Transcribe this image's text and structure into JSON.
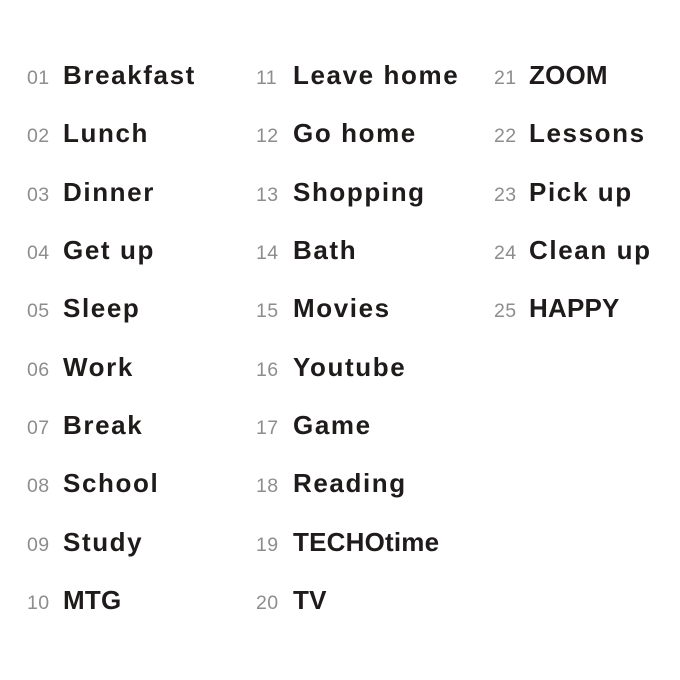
{
  "sheet": {
    "background_color": "#ffffff",
    "number_color": "#8d8d8d",
    "label_color": "#1f1b1b"
  },
  "columns": [
    {
      "name": "column-1",
      "entries": [
        {
          "number": "01",
          "label": "Breakfast"
        },
        {
          "number": "02",
          "label": "Lunch"
        },
        {
          "number": "03",
          "label": "Dinner"
        },
        {
          "number": "04",
          "label": "Get up"
        },
        {
          "number": "05",
          "label": "Sleep"
        },
        {
          "number": "06",
          "label": "Work"
        },
        {
          "number": "07",
          "label": "Break"
        },
        {
          "number": "08",
          "label": "School"
        },
        {
          "number": "09",
          "label": "Study"
        },
        {
          "number": "10",
          "label": "MTG"
        }
      ]
    },
    {
      "name": "column-2",
      "entries": [
        {
          "number": "11",
          "label": "Leave home"
        },
        {
          "number": "12",
          "label": "Go home"
        },
        {
          "number": "13",
          "label": "Shopping"
        },
        {
          "number": "14",
          "label": "Bath"
        },
        {
          "number": "15",
          "label": "Movies"
        },
        {
          "number": "16",
          "label": "Youtube"
        },
        {
          "number": "17",
          "label": "Game"
        },
        {
          "number": "18",
          "label": "Reading"
        },
        {
          "number": "19",
          "label": "TECHOtime"
        },
        {
          "number": "20",
          "label": "TV"
        }
      ]
    },
    {
      "name": "column-3",
      "entries": [
        {
          "number": "21",
          "label": "ZOOM"
        },
        {
          "number": "22",
          "label": "Lessons"
        },
        {
          "number": "23",
          "label": "Pick up"
        },
        {
          "number": "24",
          "label": "Clean up"
        },
        {
          "number": "25",
          "label": "HAPPY"
        }
      ]
    }
  ]
}
